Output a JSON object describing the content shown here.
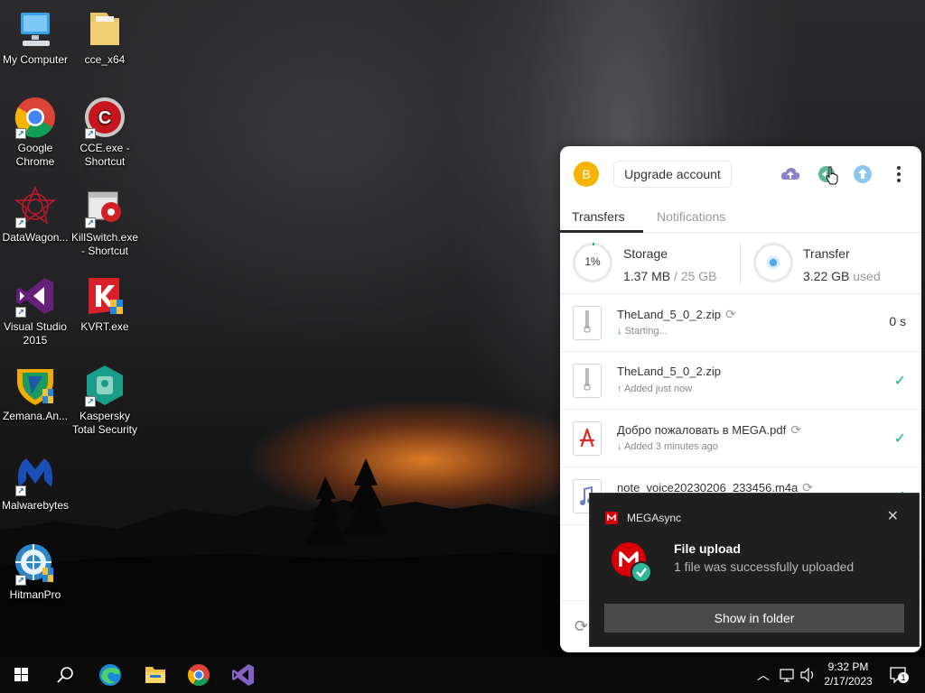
{
  "desktop": {
    "icons": [
      {
        "label": "My Computer",
        "icon": "computer-icon"
      },
      {
        "label": "cce_x64",
        "icon": "folder-icon"
      },
      {
        "label": "Google Chrome",
        "icon": "chrome-icon"
      },
      {
        "label": "CCE.exe - Shortcut",
        "icon": "cce-icon"
      },
      {
        "label": "DataWagon...",
        "icon": "datawagon-icon"
      },
      {
        "label": "KillSwitch.exe - Shortcut",
        "icon": "killswitch-icon"
      },
      {
        "label": "Visual Studio 2015",
        "icon": "visual-studio-icon"
      },
      {
        "label": "KVRT.exe",
        "icon": "kvrt-icon"
      },
      {
        "label": "Zemana.An...",
        "icon": "zemana-icon"
      },
      {
        "label": "Kaspersky Total Security",
        "icon": "kaspersky-icon"
      },
      {
        "label": "Malwarebytes",
        "icon": "malwarebytes-icon"
      },
      {
        "label": "HitmanPro",
        "icon": "hitmanpro-icon"
      }
    ]
  },
  "mega": {
    "avatar_initial": "B",
    "upgrade_label": "Upgrade account",
    "tabs": {
      "transfers": "Transfers",
      "notifications": "Notifications"
    },
    "storage": {
      "ring_label": "1%",
      "title": "Storage",
      "used": "1.37 MB",
      "total": "/ 25 GB",
      "percent": 1
    },
    "transfer": {
      "title": "Transfer",
      "value": "3.22 GB",
      "suffix": "used"
    },
    "transfers": [
      {
        "name": "TheLand_5_0_2.zip",
        "status": "Starting...",
        "right": "0 s",
        "direction": "down",
        "synced": true,
        "done": false
      },
      {
        "name": "TheLand_5_0_2.zip",
        "status": "Added just now",
        "right": "",
        "direction": "up",
        "synced": false,
        "done": true
      },
      {
        "name": "Добро пожаловать в MEGA.pdf",
        "status": "Added 3 minutes ago",
        "right": "",
        "direction": "down",
        "synced": true,
        "done": true
      },
      {
        "name": "note_voice20230206_233456.m4a",
        "status": "",
        "right": "",
        "direction": "down",
        "synced": true,
        "done": true
      }
    ]
  },
  "toast": {
    "app_name": "MEGAsync",
    "title": "File upload",
    "message": "1 file was successfully uploaded",
    "button": "Show in folder"
  },
  "taskbar": {
    "time": "9:32 PM",
    "date": "2/17/2023",
    "notification_count": "1"
  },
  "colors": {
    "mega_red": "#d90007",
    "mega_green": "#14b38d",
    "avatar": "#f5b400"
  }
}
